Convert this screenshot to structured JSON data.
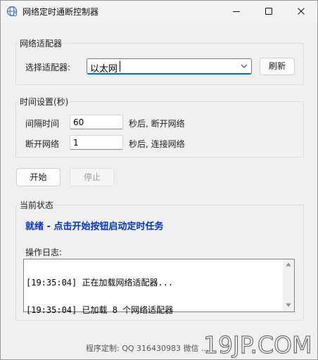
{
  "window": {
    "title": "网络定时通断控制器",
    "icon": "network-globe-icon"
  },
  "adapter_group": {
    "legend": "网络适配器",
    "select_label": "选择适配器:",
    "selected_adapter": "以太网",
    "refresh_label": "刷新"
  },
  "time_group": {
    "legend": "时间设置(秒)",
    "interval_label": "间隔时间",
    "interval_value": "60",
    "interval_suffix": "秒后, 断开网络",
    "disconnect_label": "断开网络",
    "disconnect_value": "1",
    "disconnect_suffix": "秒后, 连接网络"
  },
  "controls": {
    "start_label": "开始",
    "stop_label": "停止",
    "stop_enabled": false
  },
  "status_group": {
    "legend": "当前状态",
    "status_text": "就绪 - 点击开始按钮启动定时任务",
    "status_color": "#0033cc",
    "log_label": "操作日志:",
    "log_lines": [
      "[19:35:04] 正在加载网络适配器...",
      "[19:35:04] 已加载 8 个网络适配器"
    ]
  },
  "footer": {
    "text": "程序定制: QQ 316430983 微信 ..."
  },
  "watermark": {
    "text": "19JP.COM"
  }
}
